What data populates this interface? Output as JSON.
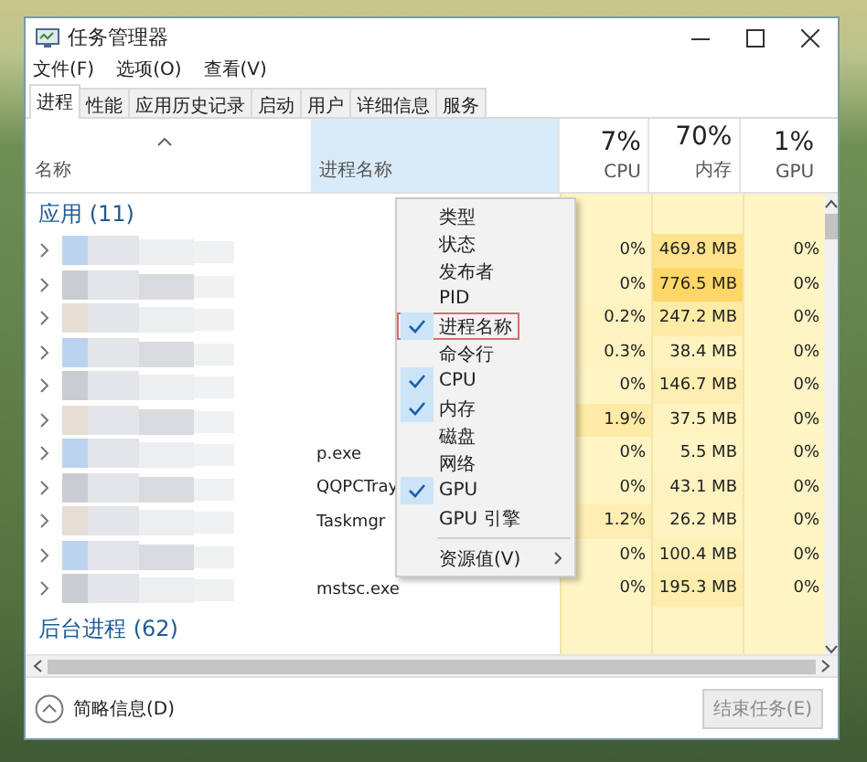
{
  "window": {
    "title": "任务管理器"
  },
  "menu_bar": [
    "文件(F)",
    "选项(O)",
    "查看(V)"
  ],
  "tabs": [
    {
      "label": "进程",
      "selected": true
    },
    {
      "label": "性能",
      "selected": false
    },
    {
      "label": "应用历史记录",
      "selected": false
    },
    {
      "label": "启动",
      "selected": false
    },
    {
      "label": "用户",
      "selected": false
    },
    {
      "label": "详细信息",
      "selected": false
    },
    {
      "label": "服务",
      "selected": false
    }
  ],
  "table": {
    "columns": [
      {
        "label": "名称",
        "kind": "name",
        "highlighted": false
      },
      {
        "label": "进程名称",
        "kind": "process",
        "highlighted": true
      },
      {
        "label": "CPU",
        "percent": "7%",
        "kind": "metric",
        "highlighted": false
      },
      {
        "label": "内存",
        "percent": "70%",
        "kind": "metric",
        "highlighted": false
      },
      {
        "label": "GPU",
        "percent": "1%",
        "kind": "metric",
        "highlighted": false
      }
    ],
    "groups": [
      {
        "title": "应用 (11)",
        "rows": [
          {
            "cpu": "0%",
            "memory": "469.8 MB",
            "gpu": "0%"
          },
          {
            "cpu": "0%",
            "memory": "776.5 MB",
            "gpu": "0%"
          },
          {
            "cpu": "0.2%",
            "memory": "247.2 MB",
            "gpu": "0%"
          },
          {
            "cpu": "0.3%",
            "memory": "38.4 MB",
            "gpu": "0%"
          },
          {
            "cpu": "0%",
            "memory": "146.7 MB",
            "gpu": "0%"
          },
          {
            "cpu": "1.9%",
            "memory": "37.5 MB",
            "gpu": "0%"
          },
          {
            "process": "p.exe",
            "cpu": "0%",
            "memory": "5.5 MB",
            "gpu": "0%"
          },
          {
            "process": "QQPCTray",
            "cpu": "0%",
            "memory": "43.1 MB",
            "gpu": "0%"
          },
          {
            "process": "Taskmgr",
            "cpu": "1.2%",
            "memory": "26.2 MB",
            "gpu": "0%"
          },
          {
            "cpu": "0%",
            "memory": "100.4 MB",
            "gpu": "0%"
          },
          {
            "process": "mstsc.exe",
            "cpu": "0%",
            "memory": "195.3 MB",
            "gpu": "0%"
          }
        ]
      },
      {
        "title": "后台进程 (62)"
      }
    ]
  },
  "context_menu": {
    "items": [
      {
        "label": "类型",
        "kind": "toggle",
        "checked": false,
        "selected": false
      },
      {
        "label": "状态",
        "kind": "toggle",
        "checked": false,
        "selected": false
      },
      {
        "label": "发布者",
        "kind": "toggle",
        "checked": false,
        "selected": false
      },
      {
        "label": "PID",
        "kind": "toggle",
        "checked": false,
        "selected": false
      },
      {
        "label": "进程名称",
        "kind": "toggle",
        "checked": true,
        "selected": true
      },
      {
        "label": "命令行",
        "kind": "toggle",
        "checked": false,
        "selected": false
      },
      {
        "label": "CPU",
        "kind": "toggle",
        "checked": true,
        "selected": false
      },
      {
        "label": "内存",
        "kind": "toggle",
        "checked": true,
        "selected": false
      },
      {
        "label": "磁盘",
        "kind": "toggle",
        "checked": false,
        "selected": false
      },
      {
        "label": "网络",
        "kind": "toggle",
        "checked": false,
        "selected": false
      },
      {
        "label": "GPU",
        "kind": "toggle",
        "checked": true,
        "selected": false
      },
      {
        "label": "GPU 引擎",
        "kind": "toggle",
        "checked": false,
        "selected": false
      },
      {
        "label": "资源值(V)",
        "kind": "submenu",
        "checked": false,
        "selected": false
      }
    ]
  },
  "footer": {
    "details_toggle": "简略信息(D)",
    "end_task": {
      "label": "结束任务(E)",
      "disabled": true
    }
  }
}
